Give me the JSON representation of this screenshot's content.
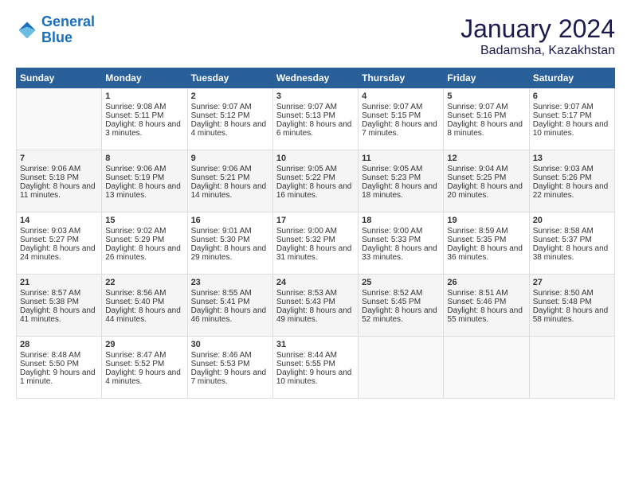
{
  "header": {
    "logo_line1": "General",
    "logo_line2": "Blue",
    "month": "January 2024",
    "location": "Badamsha, Kazakhstan"
  },
  "weekdays": [
    "Sunday",
    "Monday",
    "Tuesday",
    "Wednesday",
    "Thursday",
    "Friday",
    "Saturday"
  ],
  "weeks": [
    [
      {
        "day": "",
        "sunrise": "",
        "sunset": "",
        "daylight": ""
      },
      {
        "day": "1",
        "sunrise": "Sunrise: 9:08 AM",
        "sunset": "Sunset: 5:11 PM",
        "daylight": "Daylight: 8 hours and 3 minutes."
      },
      {
        "day": "2",
        "sunrise": "Sunrise: 9:07 AM",
        "sunset": "Sunset: 5:12 PM",
        "daylight": "Daylight: 8 hours and 4 minutes."
      },
      {
        "day": "3",
        "sunrise": "Sunrise: 9:07 AM",
        "sunset": "Sunset: 5:13 PM",
        "daylight": "Daylight: 8 hours and 6 minutes."
      },
      {
        "day": "4",
        "sunrise": "Sunrise: 9:07 AM",
        "sunset": "Sunset: 5:15 PM",
        "daylight": "Daylight: 8 hours and 7 minutes."
      },
      {
        "day": "5",
        "sunrise": "Sunrise: 9:07 AM",
        "sunset": "Sunset: 5:16 PM",
        "daylight": "Daylight: 8 hours and 8 minutes."
      },
      {
        "day": "6",
        "sunrise": "Sunrise: 9:07 AM",
        "sunset": "Sunset: 5:17 PM",
        "daylight": "Daylight: 8 hours and 10 minutes."
      }
    ],
    [
      {
        "day": "7",
        "sunrise": "Sunrise: 9:06 AM",
        "sunset": "Sunset: 5:18 PM",
        "daylight": "Daylight: 8 hours and 11 minutes."
      },
      {
        "day": "8",
        "sunrise": "Sunrise: 9:06 AM",
        "sunset": "Sunset: 5:19 PM",
        "daylight": "Daylight: 8 hours and 13 minutes."
      },
      {
        "day": "9",
        "sunrise": "Sunrise: 9:06 AM",
        "sunset": "Sunset: 5:21 PM",
        "daylight": "Daylight: 8 hours and 14 minutes."
      },
      {
        "day": "10",
        "sunrise": "Sunrise: 9:05 AM",
        "sunset": "Sunset: 5:22 PM",
        "daylight": "Daylight: 8 hours and 16 minutes."
      },
      {
        "day": "11",
        "sunrise": "Sunrise: 9:05 AM",
        "sunset": "Sunset: 5:23 PM",
        "daylight": "Daylight: 8 hours and 18 minutes."
      },
      {
        "day": "12",
        "sunrise": "Sunrise: 9:04 AM",
        "sunset": "Sunset: 5:25 PM",
        "daylight": "Daylight: 8 hours and 20 minutes."
      },
      {
        "day": "13",
        "sunrise": "Sunrise: 9:03 AM",
        "sunset": "Sunset: 5:26 PM",
        "daylight": "Daylight: 8 hours and 22 minutes."
      }
    ],
    [
      {
        "day": "14",
        "sunrise": "Sunrise: 9:03 AM",
        "sunset": "Sunset: 5:27 PM",
        "daylight": "Daylight: 8 hours and 24 minutes."
      },
      {
        "day": "15",
        "sunrise": "Sunrise: 9:02 AM",
        "sunset": "Sunset: 5:29 PM",
        "daylight": "Daylight: 8 hours and 26 minutes."
      },
      {
        "day": "16",
        "sunrise": "Sunrise: 9:01 AM",
        "sunset": "Sunset: 5:30 PM",
        "daylight": "Daylight: 8 hours and 29 minutes."
      },
      {
        "day": "17",
        "sunrise": "Sunrise: 9:00 AM",
        "sunset": "Sunset: 5:32 PM",
        "daylight": "Daylight: 8 hours and 31 minutes."
      },
      {
        "day": "18",
        "sunrise": "Sunrise: 9:00 AM",
        "sunset": "Sunset: 5:33 PM",
        "daylight": "Daylight: 8 hours and 33 minutes."
      },
      {
        "day": "19",
        "sunrise": "Sunrise: 8:59 AM",
        "sunset": "Sunset: 5:35 PM",
        "daylight": "Daylight: 8 hours and 36 minutes."
      },
      {
        "day": "20",
        "sunrise": "Sunrise: 8:58 AM",
        "sunset": "Sunset: 5:37 PM",
        "daylight": "Daylight: 8 hours and 38 minutes."
      }
    ],
    [
      {
        "day": "21",
        "sunrise": "Sunrise: 8:57 AM",
        "sunset": "Sunset: 5:38 PM",
        "daylight": "Daylight: 8 hours and 41 minutes."
      },
      {
        "day": "22",
        "sunrise": "Sunrise: 8:56 AM",
        "sunset": "Sunset: 5:40 PM",
        "daylight": "Daylight: 8 hours and 44 minutes."
      },
      {
        "day": "23",
        "sunrise": "Sunrise: 8:55 AM",
        "sunset": "Sunset: 5:41 PM",
        "daylight": "Daylight: 8 hours and 46 minutes."
      },
      {
        "day": "24",
        "sunrise": "Sunrise: 8:53 AM",
        "sunset": "Sunset: 5:43 PM",
        "daylight": "Daylight: 8 hours and 49 minutes."
      },
      {
        "day": "25",
        "sunrise": "Sunrise: 8:52 AM",
        "sunset": "Sunset: 5:45 PM",
        "daylight": "Daylight: 8 hours and 52 minutes."
      },
      {
        "day": "26",
        "sunrise": "Sunrise: 8:51 AM",
        "sunset": "Sunset: 5:46 PM",
        "daylight": "Daylight: 8 hours and 55 minutes."
      },
      {
        "day": "27",
        "sunrise": "Sunrise: 8:50 AM",
        "sunset": "Sunset: 5:48 PM",
        "daylight": "Daylight: 8 hours and 58 minutes."
      }
    ],
    [
      {
        "day": "28",
        "sunrise": "Sunrise: 8:48 AM",
        "sunset": "Sunset: 5:50 PM",
        "daylight": "Daylight: 9 hours and 1 minute."
      },
      {
        "day": "29",
        "sunrise": "Sunrise: 8:47 AM",
        "sunset": "Sunset: 5:52 PM",
        "daylight": "Daylight: 9 hours and 4 minutes."
      },
      {
        "day": "30",
        "sunrise": "Sunrise: 8:46 AM",
        "sunset": "Sunset: 5:53 PM",
        "daylight": "Daylight: 9 hours and 7 minutes."
      },
      {
        "day": "31",
        "sunrise": "Sunrise: 8:44 AM",
        "sunset": "Sunset: 5:55 PM",
        "daylight": "Daylight: 9 hours and 10 minutes."
      },
      {
        "day": "",
        "sunrise": "",
        "sunset": "",
        "daylight": ""
      },
      {
        "day": "",
        "sunrise": "",
        "sunset": "",
        "daylight": ""
      },
      {
        "day": "",
        "sunrise": "",
        "sunset": "",
        "daylight": ""
      }
    ]
  ]
}
